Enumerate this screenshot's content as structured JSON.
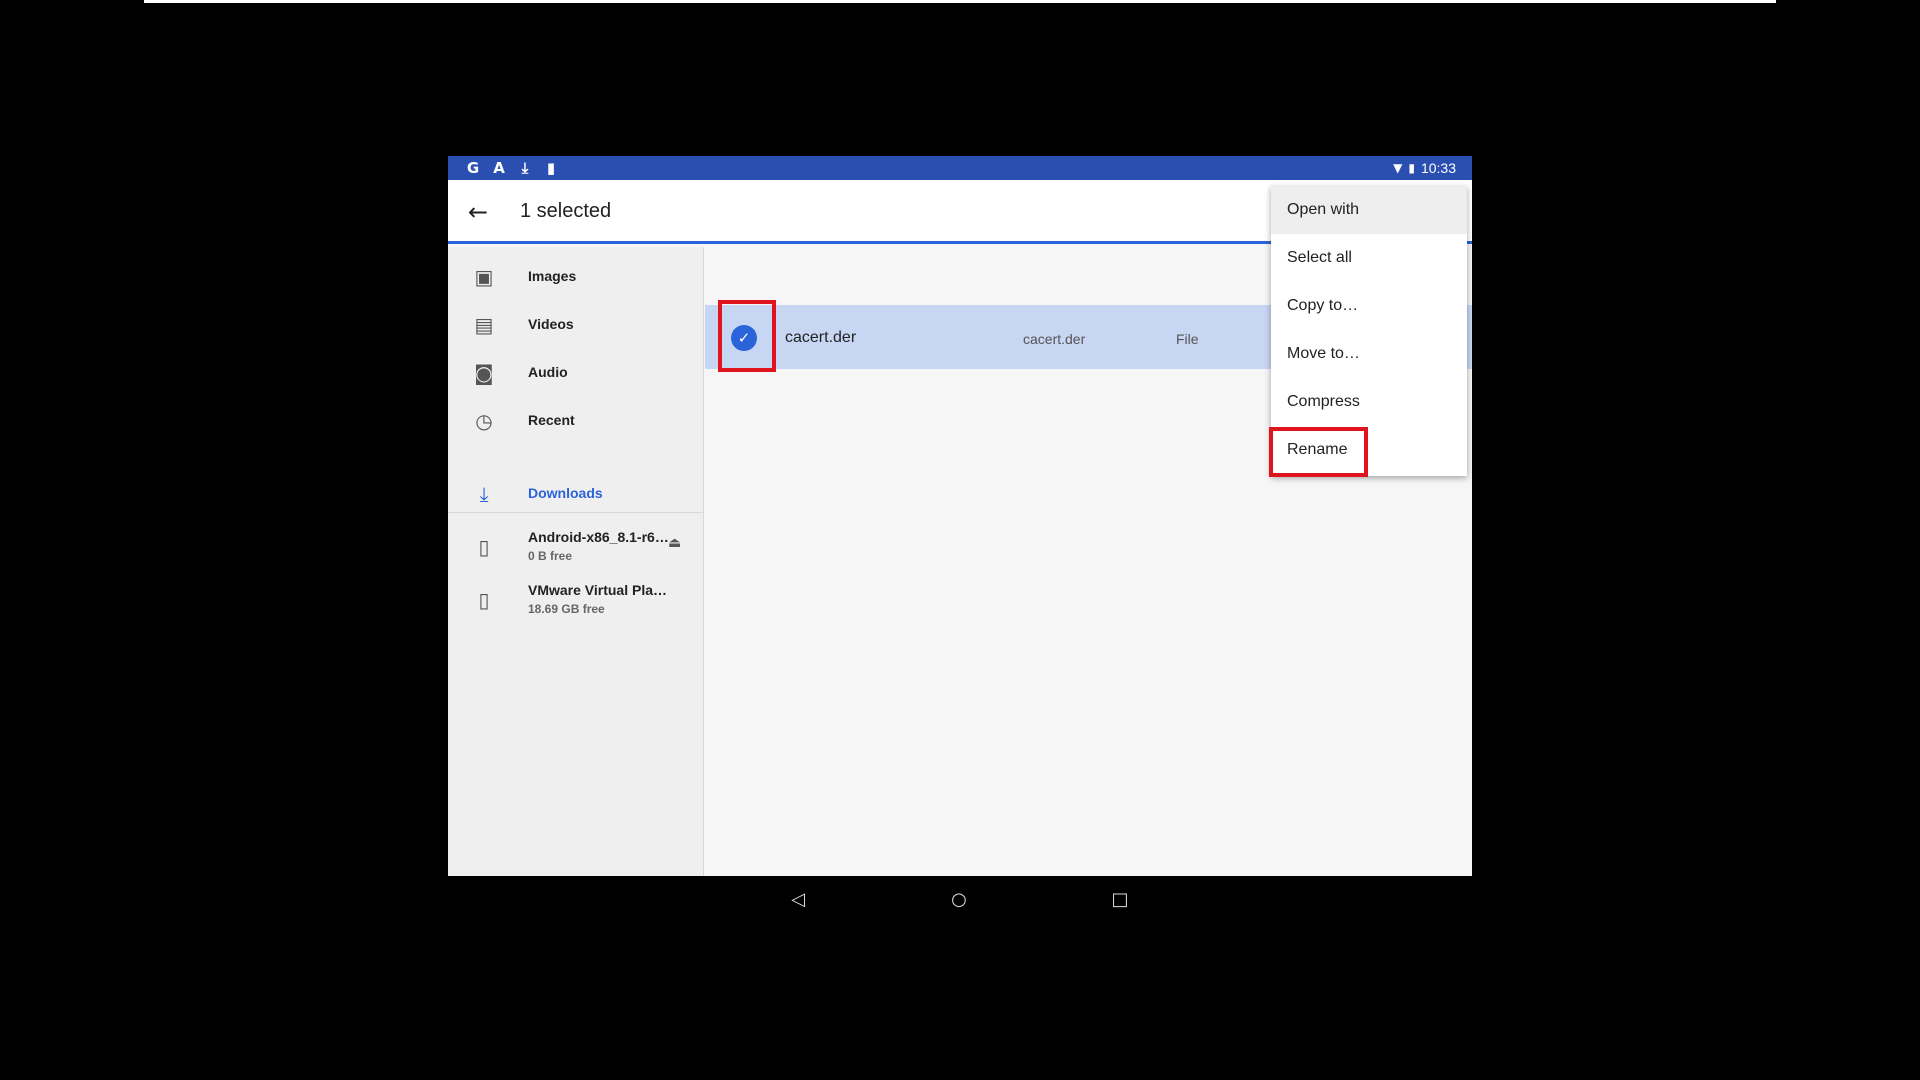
{
  "statusbar": {
    "left_icons": [
      "G",
      "A",
      "⤓",
      "▮"
    ],
    "time": "10:33",
    "wifi_icon": "▼",
    "battery_icon": "▮"
  },
  "appbar": {
    "back_icon": "←",
    "title": "1 selected"
  },
  "sidebar": {
    "items": [
      {
        "label": "Images",
        "icon": "▣"
      },
      {
        "label": "Videos",
        "icon": "▤"
      },
      {
        "label": "Audio",
        "icon": "◙"
      },
      {
        "label": "Recent",
        "icon": "◷"
      }
    ],
    "roots": [
      {
        "label": "Downloads",
        "icon": "⤓"
      },
      {
        "label": "Android-x86_8.1-r6…",
        "sub": "0 B free",
        "icon": "▯",
        "eject": "⏏"
      },
      {
        "label": "VMware Virtual Pla…",
        "sub": "18.69 GB free",
        "icon": "▯"
      }
    ]
  },
  "file": {
    "check_icon": "✓",
    "name": "cacert.der",
    "summary": "cacert.der",
    "type": "File"
  },
  "menu": {
    "items": [
      "Open with",
      "Select all",
      "Copy to…",
      "Move to…",
      "Compress",
      "Rename"
    ]
  },
  "navbar": {
    "back": "◁",
    "home": "○",
    "recents": "□"
  },
  "colors": {
    "statusbar": "#2b4fb0",
    "accent": "#2b63d9",
    "selected_row": "#c7d6f3",
    "highlight": "#e0141e"
  }
}
